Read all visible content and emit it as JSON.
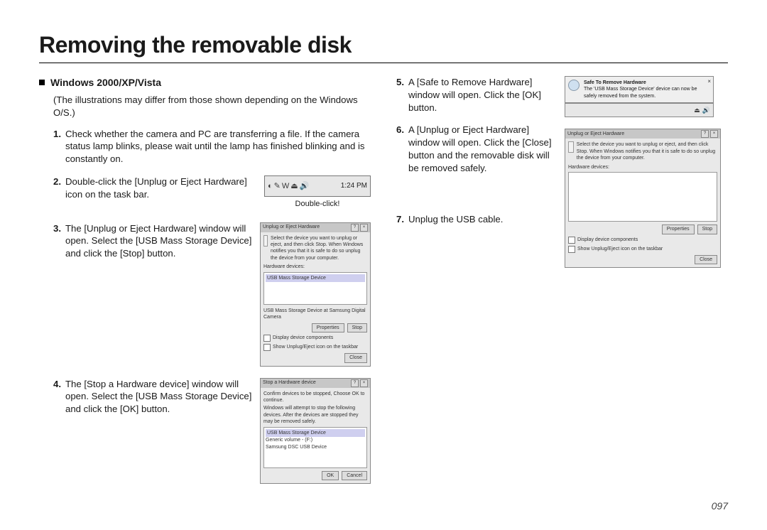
{
  "title": "Removing the removable disk",
  "subhead": "Windows 2000/XP/Vista",
  "note": "(The illustrations may differ from those shown depending on the Windows O/S.)",
  "left": {
    "s1": {
      "num": "1.",
      "txt": "Check whether the camera and PC are transferring a file. If the camera status lamp blinks, please wait until the lamp has finished blinking and is constantly on."
    },
    "s2": {
      "num": "2.",
      "txt": "Double-click the [Unplug or Eject Hardware] icon on the task bar."
    },
    "tray_time": "1:24 PM",
    "tray_caption": "Double-click!",
    "s3": {
      "num": "3.",
      "txt": "The [Unplug or Eject Hardware] window will open. Select the [USB Mass Storage Device] and click the [Stop] button."
    },
    "dlg3": {
      "title": "Unplug or Eject Hardware",
      "hint": "Select the device you want to unplug or eject, and then click Stop. When Windows notifies you that it is safe to do so unplug the device from your computer.",
      "label": "Hardware devices:",
      "item": "USB Mass Storage Device",
      "sub": "USB Mass Storage Device at Samsung Digital Camera",
      "btn1": "Properties",
      "btn2": "Stop",
      "chk1": "Display device components",
      "chk2": "Show Unplug/Eject icon on the taskbar",
      "close": "Close"
    },
    "s4": {
      "num": "4.",
      "txt": "The [Stop a Hardware device] window will open. Select the [USB Mass Storage Device] and click the [OK] button."
    },
    "dlg4": {
      "title": "Stop a Hardware device",
      "hint": "Confirm devices to be stopped, Choose OK to continue.",
      "hint2": "Windows will attempt to stop the following devices. After the devices are stopped they may be removed safely.",
      "item1": "USB Mass Storage Device",
      "item2": "Generic volume - (F:)",
      "item3": "Samsung DSC USB Device",
      "ok": "OK",
      "cancel": "Cancel"
    }
  },
  "right": {
    "s5": {
      "num": "5.",
      "txt": "A [Safe to Remove Hardware] window will open. Click the [OK] button."
    },
    "s6": {
      "num": "6.",
      "txt": "A [Unplug or Eject Hardware] window will open. Click the [Close] button and the removable disk will be removed safely."
    },
    "s7": {
      "num": "7.",
      "txt": "Unplug the USB cable."
    },
    "balloon": {
      "title": "Safe To Remove Hardware",
      "body": "The 'USB Mass Storage Device' device can now be safely removed from the system."
    },
    "dlg6": {
      "title": "Unplug or Eject Hardware",
      "hint": "Select the device you want to unplug or eject, and then click Stop. When Windows notifies you that it is safe to do so unplug the device from your computer.",
      "label": "Hardware devices:",
      "btn1": "Properties",
      "btn2": "Stop",
      "chk1": "Display device components",
      "chk2": "Show Unplug/Eject icon on the taskbar",
      "close": "Close"
    }
  },
  "page_number": "097"
}
